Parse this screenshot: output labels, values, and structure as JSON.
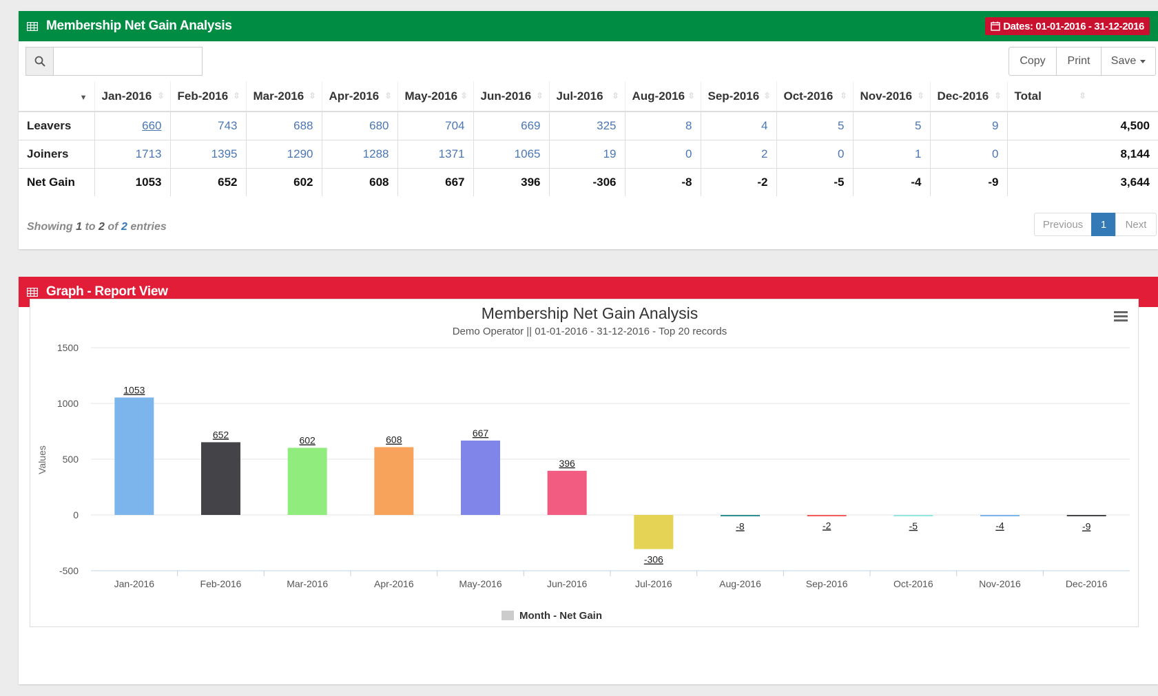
{
  "table_panel": {
    "title": "Membership Net Gain Analysis",
    "date_badge": "Dates: 01-01-2016 - 31-12-2016",
    "search": {
      "value": "",
      "placeholder": ""
    },
    "buttons": {
      "copy": "Copy",
      "print": "Print",
      "save": "Save"
    },
    "columns": [
      "Jan-2016",
      "Feb-2016",
      "Mar-2016",
      "Apr-2016",
      "May-2016",
      "Jun-2016",
      "Jul-2016",
      "Aug-2016",
      "Sep-2016",
      "Oct-2016",
      "Nov-2016",
      "Dec-2016",
      "Total"
    ],
    "rows": [
      {
        "label": "Leavers",
        "values": [
          "660",
          "743",
          "688",
          "680",
          "704",
          "669",
          "325",
          "8",
          "4",
          "5",
          "5",
          "9"
        ],
        "total": "4,500"
      },
      {
        "label": "Joiners",
        "values": [
          "1713",
          "1395",
          "1290",
          "1288",
          "1371",
          "1065",
          "19",
          "0",
          "2",
          "0",
          "1",
          "0"
        ],
        "total": "8,144"
      },
      {
        "label": "Net Gain",
        "values": [
          "1053",
          "652",
          "602",
          "608",
          "667",
          "396",
          "-306",
          "-8",
          "-2",
          "-5",
          "-4",
          "-9"
        ],
        "total": "3,644"
      }
    ],
    "info": {
      "showing": "Showing",
      "from": "1",
      "to_word": "to",
      "to": "2",
      "of_word": "of",
      "count": "2",
      "entries": "entries"
    },
    "pagination": {
      "previous": "Previous",
      "page": "1",
      "next": "Next"
    }
  },
  "graph_panel": {
    "title": "Graph - Report View"
  },
  "colors": {
    "table_header": "#008d43",
    "graph_header": "#e11d38",
    "date_badge": "#c9102f",
    "link": "#4a77b4"
  },
  "chart_data": {
    "type": "bar",
    "title": "Membership Net Gain Analysis",
    "subtitle": "Demo Operator || 01-01-2016 - 31-12-2016 - Top 20 records",
    "xlabel": "",
    "ylabel": "Values",
    "ylim": [
      -500,
      1500
    ],
    "yticks": [
      1500,
      1000,
      500,
      0,
      -500
    ],
    "categories": [
      "Jan-2016",
      "Feb-2016",
      "Mar-2016",
      "Apr-2016",
      "May-2016",
      "Jun-2016",
      "Jul-2016",
      "Aug-2016",
      "Sep-2016",
      "Oct-2016",
      "Nov-2016",
      "Dec-2016"
    ],
    "values": [
      1053,
      652,
      602,
      608,
      667,
      396,
      -306,
      -8,
      -2,
      -5,
      -4,
      -9
    ],
    "data_labels": [
      "1053",
      "652",
      "602",
      "608",
      "667",
      "396",
      "-306",
      "-8",
      "-2",
      "-5",
      "-4",
      "-9"
    ],
    "colors": [
      "#7cb5ec",
      "#434348",
      "#90ed7d",
      "#f7a35c",
      "#8085e9",
      "#f15c80",
      "#e4d354",
      "#2b908f",
      "#f45b5b",
      "#91e8e1",
      "#7cb5ec",
      "#434348"
    ],
    "legend": {
      "label": "Month - Net Gain",
      "position": "bottom-center"
    },
    "grid": true
  }
}
